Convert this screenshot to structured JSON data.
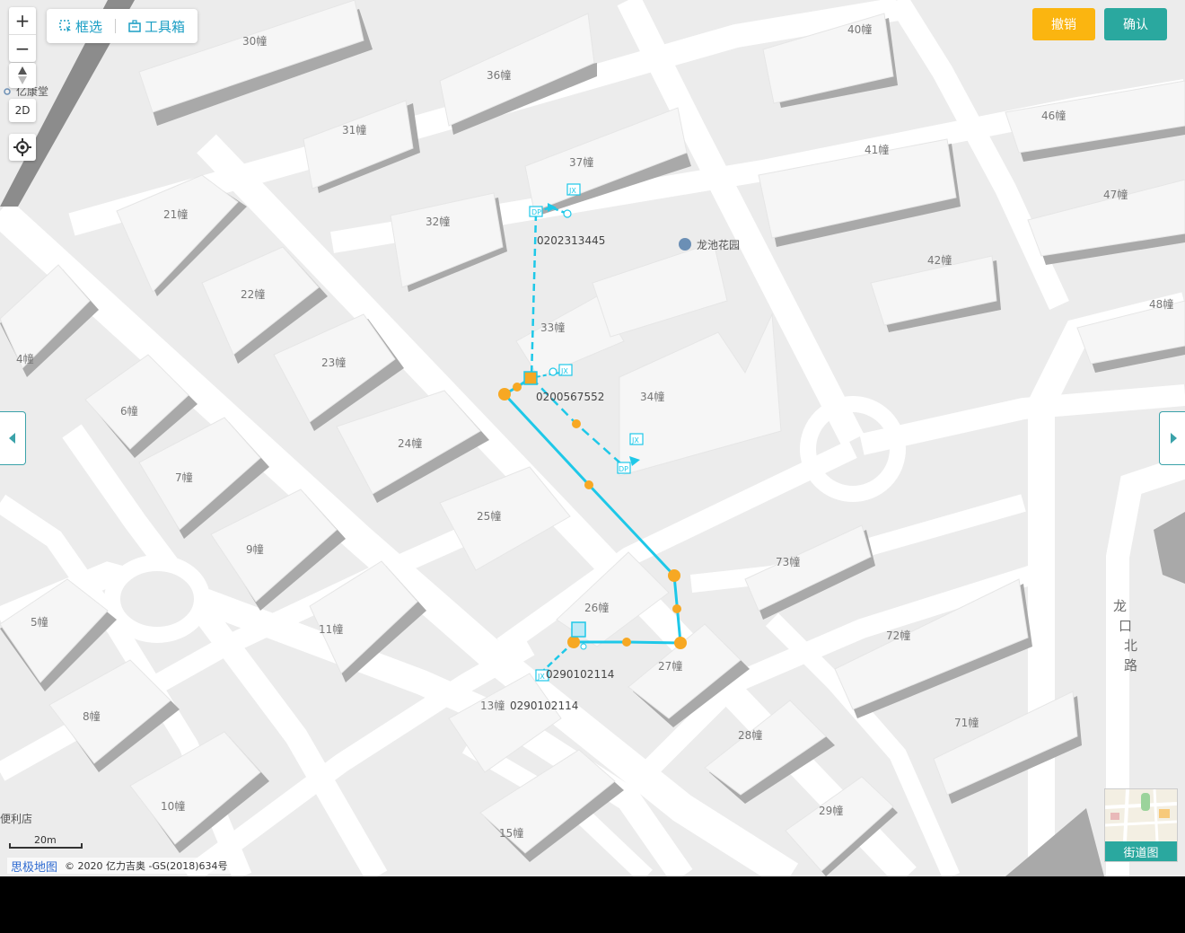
{
  "toolbar": {
    "select_label": "框选",
    "toolbox_label": "工具箱"
  },
  "actions": {
    "undo_label": "撤销",
    "confirm_label": "确认"
  },
  "map_controls": {
    "zoom_in": "+",
    "zoom_out": "−",
    "mode_2d": "2D"
  },
  "street_view": {
    "label": "街道图"
  },
  "scale": {
    "text": "20m"
  },
  "attribution": {
    "brand": "思极地图",
    "copyright": "© 2020 亿力吉奥 -GS(2018)634号"
  },
  "poi": {
    "park": "龙池花园",
    "road_name": "龙口北路",
    "shop": "便利店",
    "yikangtang": "亿康堂"
  },
  "buildings": [
    "30幢",
    "36幢",
    "40幢",
    "46幢",
    "31幢",
    "37幢",
    "41幢",
    "47幢",
    "21幢",
    "32幢",
    "42幢",
    "22幢",
    "33幢",
    "48幢",
    "4幢",
    "23幢",
    "34幢",
    "6幢",
    "24幢",
    "7幢",
    "25幢",
    "73幢",
    "9幢",
    "26幢",
    "5幢",
    "11幢",
    "72幢",
    "27幢",
    "8幢",
    "13幢",
    "71幢",
    "28幢",
    "10幢",
    "15幢",
    "29幢"
  ],
  "nodes": {
    "node_a": "0202313445",
    "node_b": "0200567552",
    "node_c": "0290102114",
    "node_d": "0290102114"
  },
  "colors": {
    "line": "#1ec8e8",
    "node": "#f7a823",
    "undo": "#fbb510",
    "confirm": "#2aa89f"
  }
}
